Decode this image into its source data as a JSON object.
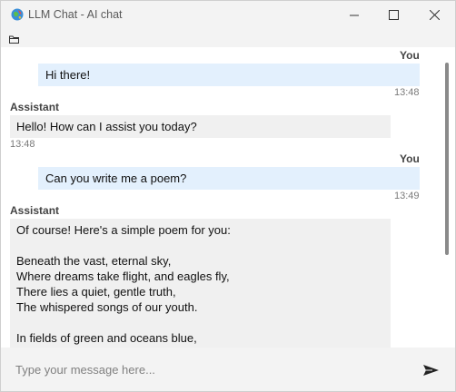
{
  "window": {
    "title": "LLM Chat - AI chat"
  },
  "messages": [
    {
      "role_label": "You",
      "text": "Hi there!",
      "time": "13:48"
    },
    {
      "role_label": "Assistant",
      "text": "Hello! How can I assist you today?",
      "time": "13:48"
    },
    {
      "role_label": "You",
      "text": "Can you write me a poem?",
      "time": "13:49"
    },
    {
      "role_label": "Assistant",
      "lines": [
        "Of course! Here's a simple poem for you:",
        "",
        "Beneath the vast, eternal sky,",
        "Where dreams take flight, and eagles fly,",
        "There lies a quiet, gentle truth,",
        "The whispered songs of our youth.",
        "",
        "In fields of green and oceans blue,"
      ]
    }
  ],
  "input": {
    "placeholder": "Type your message here...",
    "value": ""
  },
  "icons": {
    "app": "app-globe-icon",
    "minimize": "minimize-icon",
    "maximize": "maximize-icon",
    "close": "close-icon",
    "folder": "folder-icon",
    "send": "send-icon"
  },
  "colors": {
    "user_bubble": "#e3f0fd",
    "assistant_bubble": "#f0f0f0",
    "chat_background": "#ffffff",
    "window_chrome": "#f3f3f3"
  }
}
